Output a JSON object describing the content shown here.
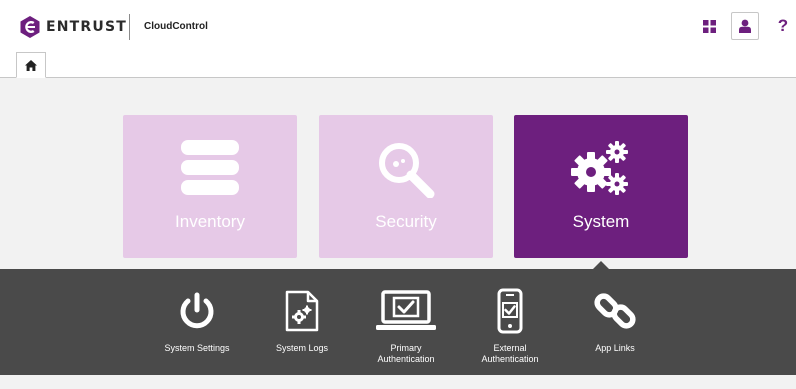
{
  "header": {
    "brand": "ENTRUST",
    "product": "CloudControl",
    "help_label": "?"
  },
  "cards": [
    {
      "label": "Inventory",
      "icon": "database-icon",
      "color": "#e6c9e7"
    },
    {
      "label": "Security",
      "icon": "search-icon",
      "color": "#e6c9e7"
    },
    {
      "label": "System",
      "icon": "gears-icon",
      "color": "#6d1f7e",
      "selected": true
    }
  ],
  "system_items": [
    {
      "line1": "System Settings",
      "line2": "",
      "icon": "power-icon"
    },
    {
      "line1": "System Logs",
      "line2": "",
      "icon": "log-file-icon"
    },
    {
      "line1": "Primary",
      "line2": "Authentication",
      "icon": "laptop-check-icon"
    },
    {
      "line1": "External",
      "line2": "Authentication",
      "icon": "phone-check-icon"
    },
    {
      "line1": "App Links",
      "line2": "",
      "icon": "link-icon"
    }
  ],
  "colors": {
    "brand_purple": "#6d1f7e",
    "card_light": "#e6c9e7",
    "subbar": "#4a4a4a",
    "background": "#f2f2f2"
  }
}
